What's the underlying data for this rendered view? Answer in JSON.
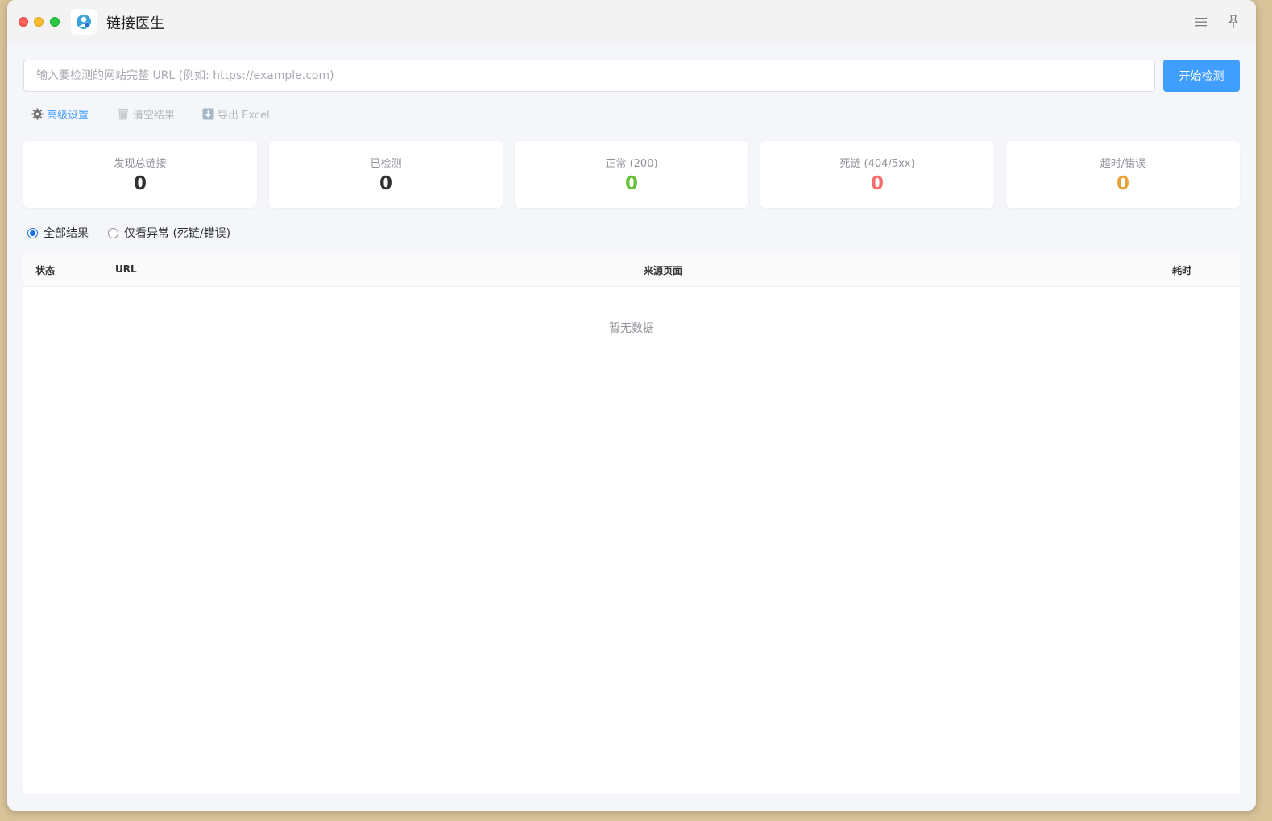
{
  "app": {
    "title": "链接医生"
  },
  "search": {
    "placeholder": "输入要检测的网站完整 URL (例如: https://example.com)",
    "value": "",
    "start_label": "开始检测"
  },
  "toolbar": {
    "advanced_label": "高级设置",
    "clear_label": "清空结果",
    "export_label": "导出 Excel"
  },
  "stats": [
    {
      "label": "发现总链接",
      "value": "0",
      "color": "#303133"
    },
    {
      "label": "已检测",
      "value": "0",
      "color": "#303133"
    },
    {
      "label": "正常 (200)",
      "value": "0",
      "color": "#67c23a"
    },
    {
      "label": "死链 (404/5xx)",
      "value": "0",
      "color": "#f56c6c"
    },
    {
      "label": "超时/错误",
      "value": "0",
      "color": "#e6a23c"
    }
  ],
  "filters": {
    "all_label": "全部结果",
    "abnormal_label": "仅看异常 (死链/错误)",
    "selected": "all"
  },
  "table": {
    "columns": [
      "状态",
      "URL",
      "来源页面",
      "耗时"
    ],
    "rows": [],
    "empty_text": "暂无数据"
  },
  "colors": {
    "accent": "#409eff"
  },
  "icons": {
    "menu": "menu-icon",
    "pin": "pin-icon",
    "settings": "gear-icon",
    "clear": "trash-icon",
    "export": "download-icon"
  }
}
